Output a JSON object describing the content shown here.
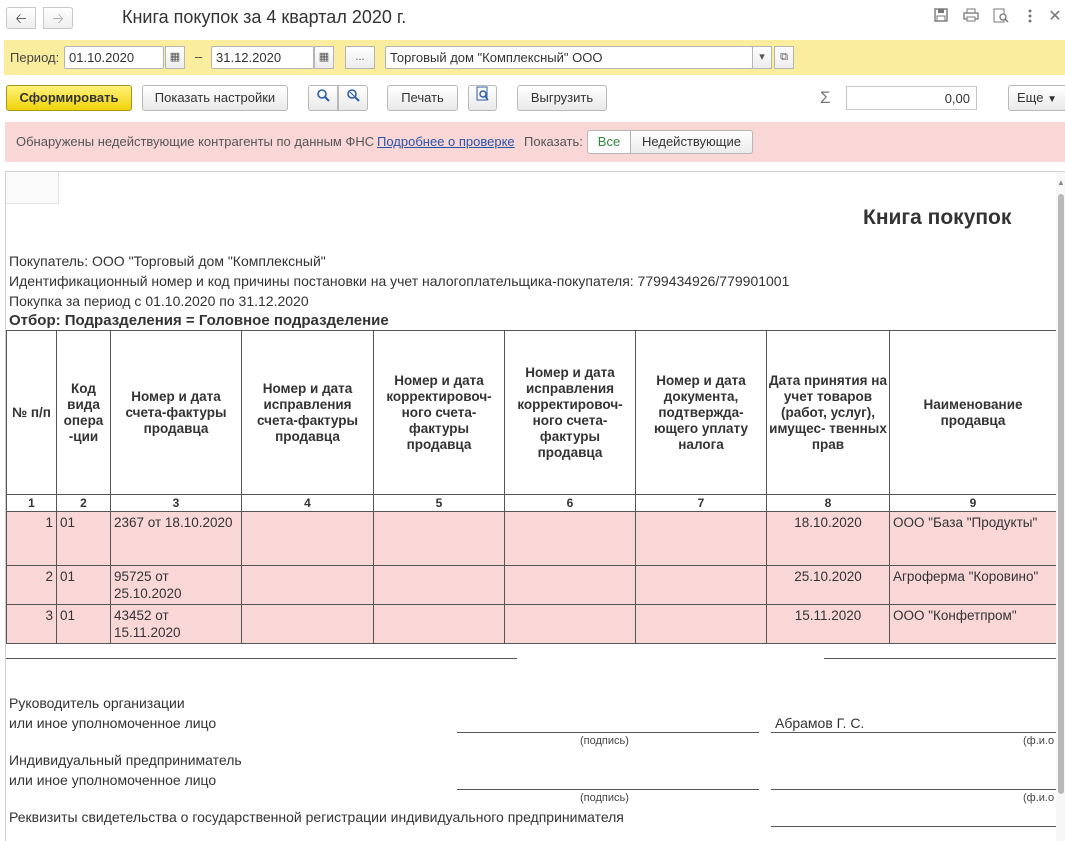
{
  "window": {
    "title": "Книга покупок за 4 квартал 2020 г.",
    "back_icon": "arrow-left-icon",
    "forward_icon": "arrow-right-icon",
    "save_icon": "floppy-icon",
    "print_icon": "printer-icon",
    "preview_icon": "magnifier-icon",
    "menu_icon": "kebab-icon",
    "close_icon": "close-icon"
  },
  "period": {
    "label": "Период:",
    "from": "01.10.2020",
    "dash": "–",
    "to": "31.12.2020",
    "ellipsis": "...",
    "organization": "Торговый дом \"Комплексный\" ООО"
  },
  "commands": {
    "generate": "Сформировать",
    "show_settings": "Показать настройки",
    "print": "Печать",
    "export": "Выгрузить",
    "sum_symbol": "Σ",
    "sum_value": "0,00",
    "more": "Еще"
  },
  "warning": {
    "text": "Обнаружены недействующие контрагенты по данным ФНС",
    "link": "Подробнее о проверке",
    "show_label": "Показать:",
    "filter_all": "Все",
    "filter_inactive": "Недействующие"
  },
  "report": {
    "title": "Книга покупок",
    "buyer": "Покупатель:  ООО \"Торговый дом \"Комплексный\"",
    "inn": "Идентификационный номер и код причины постановки на учет налогоплательщика-покупателя:  7799434926/779901001",
    "period": "Покупка за период с 01.10.2020 по 31.12.2020",
    "filter": "Отбор: Подразделения = Головное подразделение",
    "columns": {
      "c1": "№ п/п",
      "c2": "Код вида опера -ции",
      "c3": "Номер и дата счета-фактуры продавца",
      "c4": "Номер и дата исправления счета-фактуры продавца",
      "c5": "Номер и дата корректировоч- ного счета-фактуры продавца",
      "c6": "Номер и дата исправления корректировоч- ного счета-фактуры продавца",
      "c7": "Номер и дата документа, подтвержда- ющего уплату налога",
      "c8": "Дата принятия на учет товаров (работ, услуг), имущес- твенных прав",
      "c9": "Наименование продавца"
    },
    "column_numbers": [
      "1",
      "2",
      "3",
      "4",
      "5",
      "6",
      "7",
      "8",
      "9"
    ],
    "rows": [
      {
        "n": "1",
        "code": "01",
        "invoice": "2367 от 18.10.2020",
        "accepted": "18.10.2020",
        "seller": "ООО \"База \"Продукты\""
      },
      {
        "n": "2",
        "code": "01",
        "invoice": "95725 от 25.10.2020",
        "accepted": "25.10.2020",
        "seller": "Агроферма \"Коровино\""
      },
      {
        "n": "3",
        "code": "01",
        "invoice": "43452 от 15.11.2020",
        "accepted": "15.11.2020",
        "seller": "ООО \"Конфетпром\""
      }
    ],
    "signatures": {
      "head_line1": "Руководитель организации",
      "head_line2": "или иное уполномоченное лицо",
      "head_name": "Абрамов Г. С.",
      "signature_hint": "(подпись)",
      "fio_hint": "(ф.и.о",
      "ip_line1": "Индивидуальный предприниматель",
      "ip_line2": "или иное уполномоченное лицо",
      "ip_signature_hint": "(подпись)",
      "ip_fio_hint": "(ф.и.о",
      "registration": "Реквизиты свидетельства о государственной регистрации индивидуального предпринимателя"
    }
  }
}
